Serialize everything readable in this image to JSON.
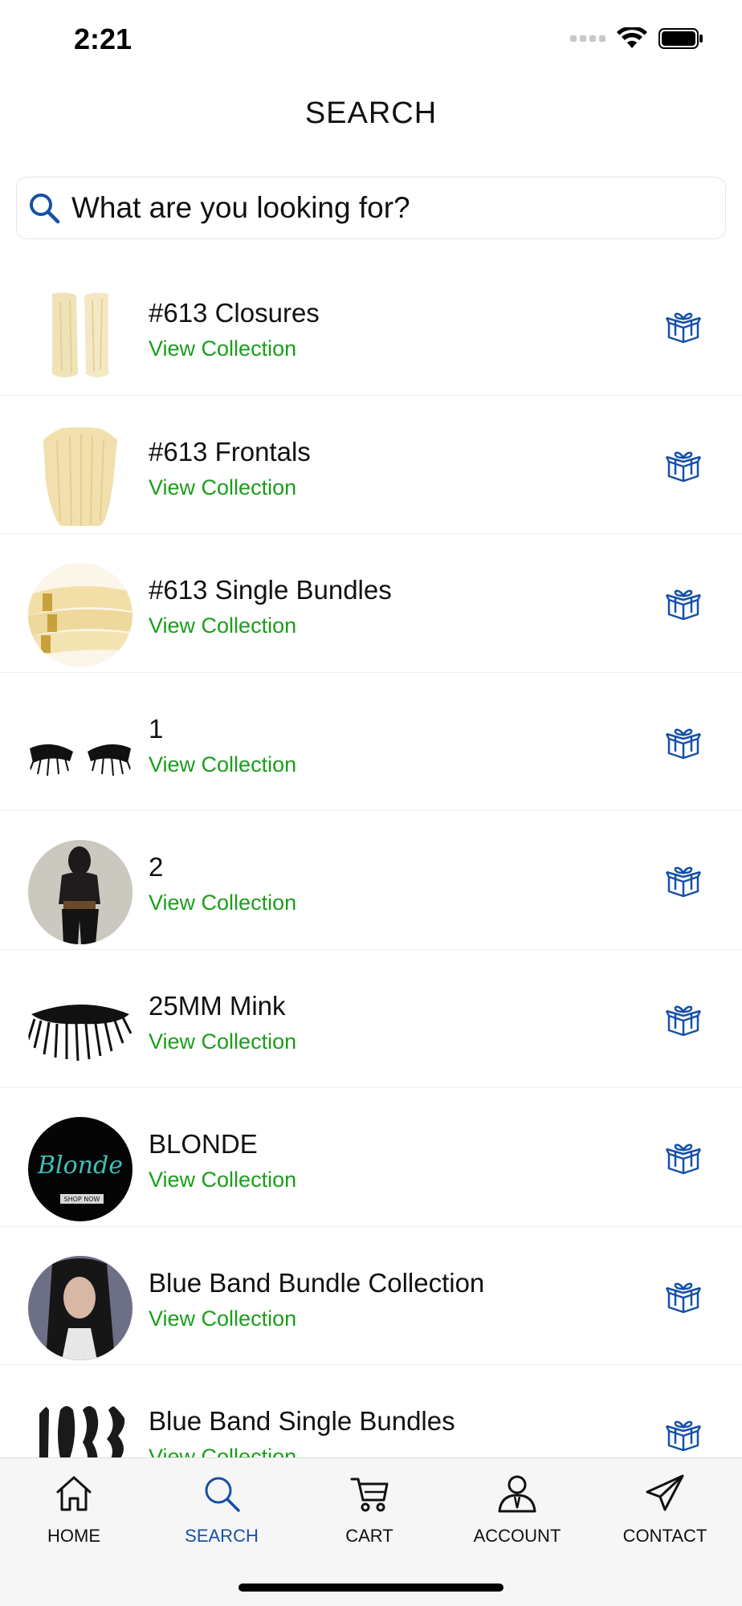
{
  "status_bar": {
    "time": "2:21"
  },
  "page": {
    "title": "SEARCH"
  },
  "search": {
    "placeholder": "What are you looking for?"
  },
  "collections": [
    {
      "title": "#613 Closures",
      "link": "View Collection"
    },
    {
      "title": "#613 Frontals",
      "link": "View Collection"
    },
    {
      "title": "#613 Single Bundles",
      "link": "View Collection"
    },
    {
      "title": "1",
      "link": "View Collection"
    },
    {
      "title": "2",
      "link": "View Collection"
    },
    {
      "title": "25MM Mink",
      "link": "View Collection"
    },
    {
      "title": "BLONDE",
      "link": "View Collection",
      "thumb_text": "Blonde",
      "thumb_subtext": "SHOP NOW"
    },
    {
      "title": "Blue Band Bundle Collection",
      "link": "View Collection"
    },
    {
      "title": "Blue Band Single Bundles",
      "link": "View Collection"
    }
  ],
  "tab_bar": {
    "tabs": [
      {
        "label": "HOME",
        "icon": "home-icon"
      },
      {
        "label": "SEARCH",
        "icon": "search-icon",
        "active": true
      },
      {
        "label": "CART",
        "icon": "cart-icon"
      },
      {
        "label": "ACCOUNT",
        "icon": "account-icon"
      },
      {
        "label": "CONTACT",
        "icon": "paper-plane-icon"
      }
    ]
  },
  "colors": {
    "accent": "#1550a8",
    "link": "#1a9e1a",
    "text": "#111111"
  }
}
